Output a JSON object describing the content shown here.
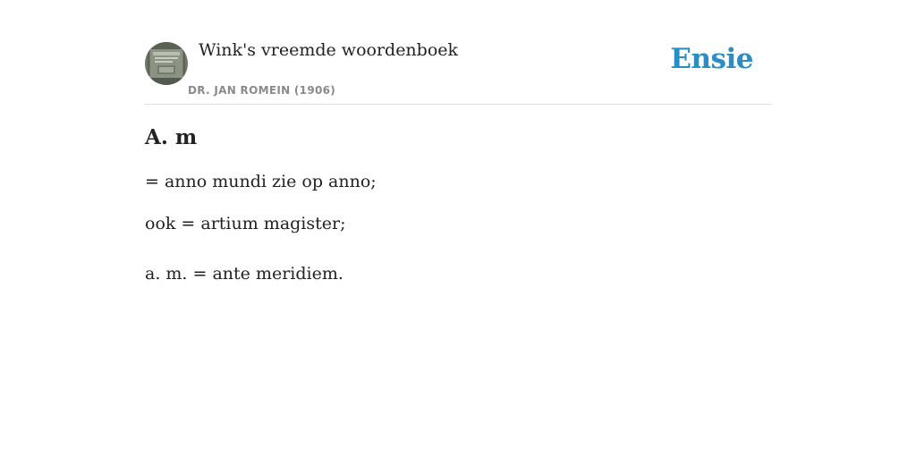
{
  "header": {
    "book_title": "Wink's vreemde woordenboek",
    "book_author": "DR. JAN ROMEIN (1906)",
    "brand": "Ensie",
    "brand_color": "#2a8dc5",
    "avatar_icon": "book-cover-thumbnail"
  },
  "entry": {
    "term": "A. m",
    "definitions": [
      "= anno mundi zie op anno;",
      "ook = artium magister;",
      "a. m. = ante meridiem."
    ]
  }
}
